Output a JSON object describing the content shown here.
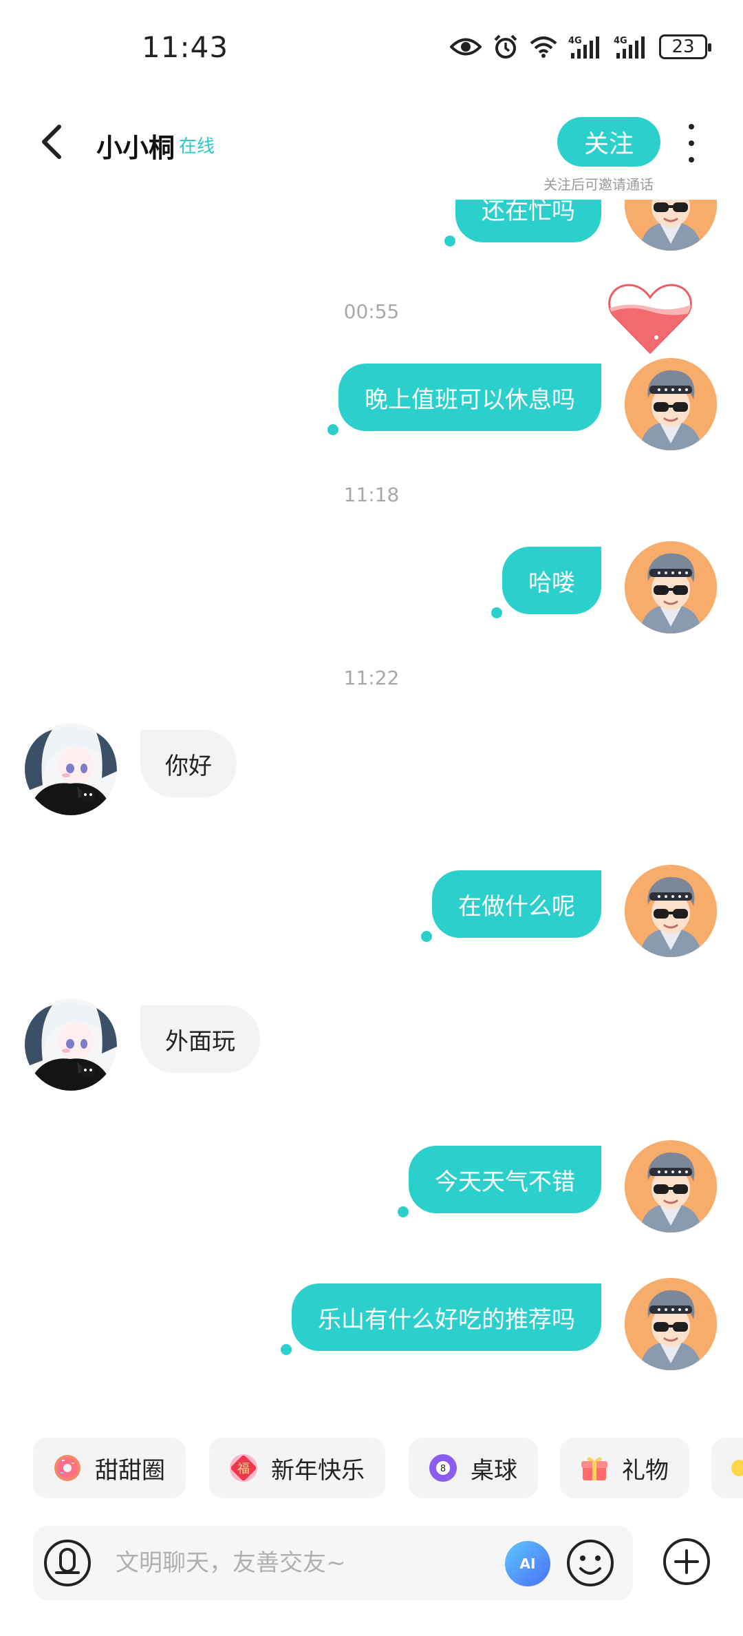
{
  "status_bar": {
    "time": "11:43",
    "battery_level": "23",
    "network_1": "4G",
    "network_2": "4G"
  },
  "header": {
    "title": "小小桐",
    "online_status": "在线",
    "follow_label": "关注",
    "follow_hint": "关注后可邀请通话"
  },
  "messages": [
    {
      "kind": "outgoing",
      "text": "还在忙吗"
    },
    {
      "kind": "timestamp",
      "text": "00:55"
    },
    {
      "kind": "outgoing",
      "text": "晚上值班可以休息吗"
    },
    {
      "kind": "timestamp",
      "text": "11:18"
    },
    {
      "kind": "outgoing",
      "text": "哈喽"
    },
    {
      "kind": "timestamp",
      "text": "11:22"
    },
    {
      "kind": "incoming",
      "text": "你好"
    },
    {
      "kind": "outgoing",
      "text": "在做什么呢"
    },
    {
      "kind": "incoming",
      "text": "外面玩"
    },
    {
      "kind": "outgoing",
      "text": "今天天气不错"
    },
    {
      "kind": "outgoing",
      "text": "乐山有什么好吃的推荐吗"
    }
  ],
  "quick_bar": {
    "items": [
      {
        "label": "甜甜圈",
        "icon": "donut-icon"
      },
      {
        "label": "新年快乐",
        "icon": "fu-blessing-icon"
      },
      {
        "label": "桌球",
        "icon": "billiard-ball-icon"
      },
      {
        "label": "礼物",
        "icon": "gift-icon"
      }
    ]
  },
  "input": {
    "placeholder": "文明聊天，友善交友~",
    "ai_label": "AI"
  },
  "colors": {
    "accent": "#2bd0cc",
    "incoming_bubble": "#f3f3f3",
    "my_avatar_bg": "#f7ac6c"
  }
}
